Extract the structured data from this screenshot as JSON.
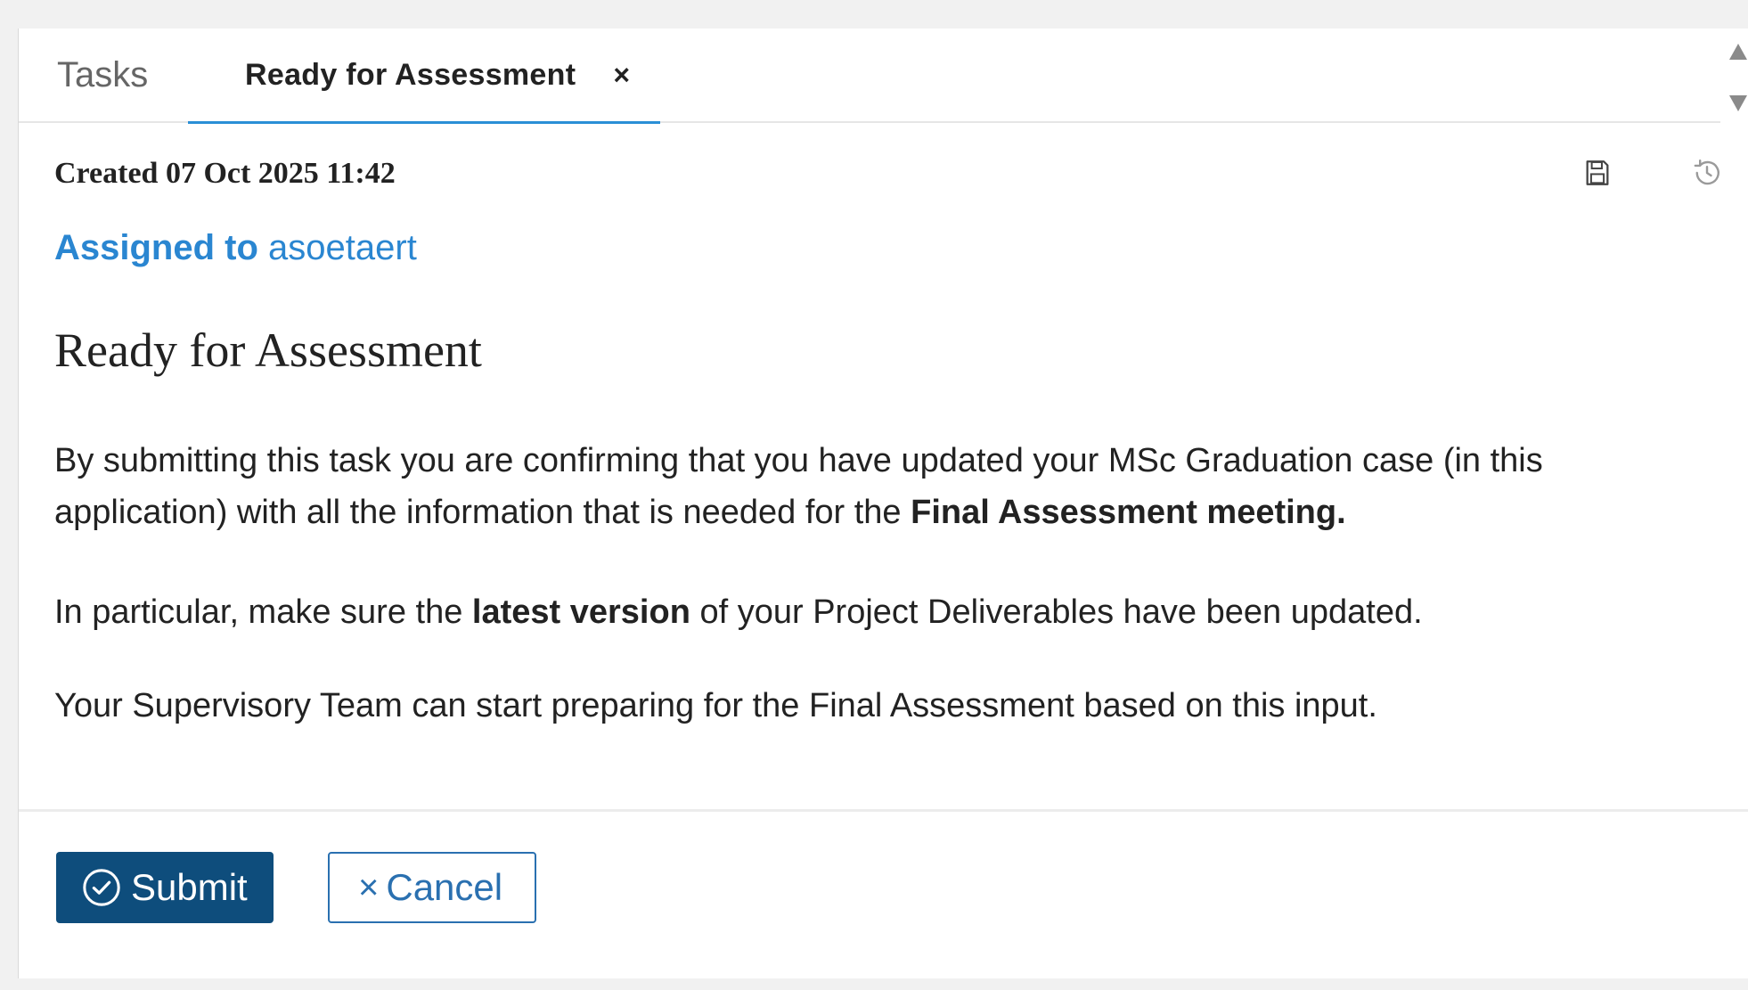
{
  "tabs": {
    "tasks_label": "Tasks",
    "active_label": "Ready for Assessment",
    "close_glyph": "×"
  },
  "task": {
    "created": "Created 07 Oct 2025 11:42",
    "assigned_label": "Assigned to",
    "assigned_user": "asoetaert",
    "title": "Ready for Assessment",
    "p1_part1": "By submitting this task you are confirming that you have updated your MSc Graduation case (in this application) with all the information that is needed for the ",
    "p1_bold": "Final Assessment meeting.",
    "p2_part1": "In particular, make sure the ",
    "p2_bold": "latest version",
    "p2_part2": " of your Project Deliverables have been updated.",
    "p3": "Your Supervisory Team can start preparing for the Final Assessment based on this input."
  },
  "actions": {
    "submit_label": "Submit",
    "cancel_label": "Cancel",
    "cancel_glyph": "×"
  },
  "icons": {
    "save": "save-icon",
    "history": "history-icon",
    "submit": "check-circle-icon",
    "scroll_up": "triangle-up-icon",
    "scroll_down": "triangle-down-icon"
  },
  "colors": {
    "accent_blue": "#2a86d1",
    "submit_bg": "#0e4d7c",
    "cancel_border": "#2a70b0",
    "tab_underline": "#2a8fd6"
  }
}
